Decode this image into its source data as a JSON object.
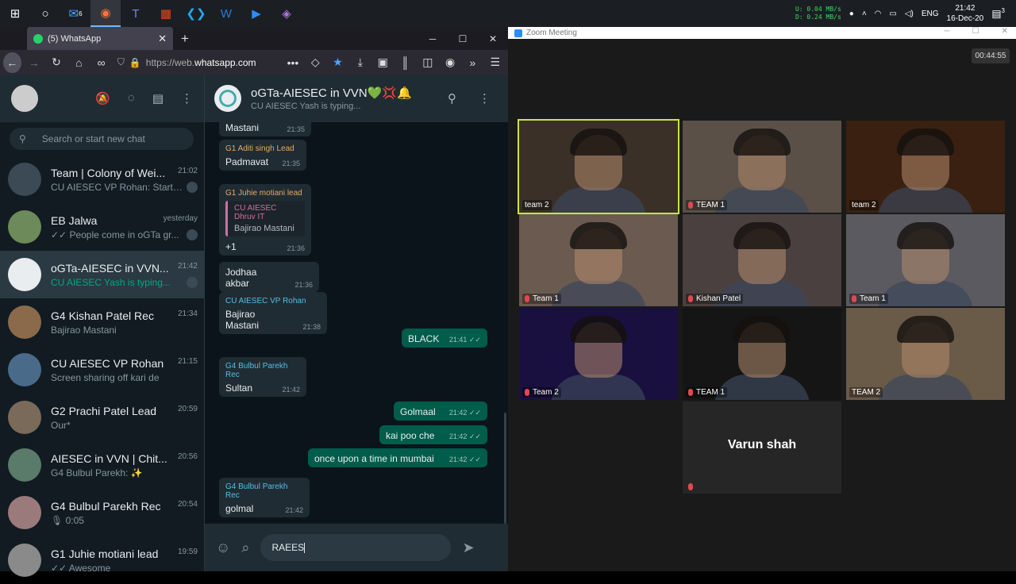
{
  "taskbar": {
    "apps": [
      {
        "name": "windows-start",
        "glyph": "⊞"
      },
      {
        "name": "search",
        "glyph": "○"
      },
      {
        "name": "mail",
        "glyph": "✉"
      },
      {
        "name": "firefox",
        "glyph": "◉"
      },
      {
        "name": "teams",
        "glyph": "T"
      },
      {
        "name": "office",
        "glyph": "▦"
      },
      {
        "name": "vscode",
        "glyph": "❮❯"
      },
      {
        "name": "word",
        "glyph": "W"
      },
      {
        "name": "zoom",
        "glyph": "▶"
      },
      {
        "name": "settings",
        "glyph": "◈"
      }
    ],
    "mail_badge": "6",
    "net_up": "U:    0.04 MB/s",
    "net_down": "D:    0.24 MB/s",
    "lang": "ENG",
    "time": "21:42",
    "date": "16-Dec-20",
    "notif_count": "3"
  },
  "browser": {
    "tab_title": "(5) WhatsApp",
    "url_prefix": "https://web.",
    "url_domain": "whatsapp.com"
  },
  "wa": {
    "search_placeholder": "Search or start new chat",
    "chats": [
      {
        "name": "Team | Colony of Wei...",
        "time": "21:02",
        "last": "CU AIESEC VP Rohan: Start ...",
        "muted": true,
        "avatar": "#3b4a54"
      },
      {
        "name": "EB Jalwa",
        "time": "yesterday",
        "last": "✓✓ People come in oGTa gr...",
        "muted": true,
        "avatar": "#6c8a5a"
      },
      {
        "name": "oGTa-AIESEC in VVN...",
        "time": "21:42",
        "last": "CU AIESEC Yash is typing...",
        "muted": true,
        "typing": true,
        "selected": true,
        "avatar": "#e9edef"
      },
      {
        "name": "G4 Kishan Patel Rec",
        "time": "21:34",
        "last": "Bajirao Mastani",
        "avatar": "#8a6a4a"
      },
      {
        "name": "CU AIESEC VP Rohan",
        "time": "21:15",
        "last": "Screen sharing off kari de",
        "avatar": "#4a6a8a"
      },
      {
        "name": "G2 Prachi Patel Lead",
        "time": "20:59",
        "last": "Our*",
        "avatar": "#7a6a5a"
      },
      {
        "name": "AIESEC in VVN | Chit...",
        "time": "20:56",
        "last": "G4 Bulbul Parekh: ✨",
        "avatar": "#5a7a6a"
      },
      {
        "name": "G4 Bulbul Parekh Rec",
        "time": "20:54",
        "last": "🎙 0:05",
        "avatar": "#9a7a7a"
      },
      {
        "name": "G1 Juhie motiani lead",
        "time": "19:59",
        "last": "✓✓ Awesome",
        "avatar": "#8a8a8a"
      }
    ],
    "conversation": {
      "name": "oGTa-AIESEC in VVN💚💢🔔",
      "status": "CU AIESEC Yash is typing...",
      "messages": [
        {
          "author": "",
          "text": "Bajirao Mastani",
          "time": "21:35",
          "out": false
        },
        {
          "author": "G1 Aditi singh Lead",
          "text": "Padmavat",
          "time": "21:35",
          "out": false,
          "ac": "c1"
        },
        {
          "author": "G1 Juhie motiani lead",
          "quote_author": "CU AIESEC Dhruv IT",
          "quote_text": "Bajirao Mastani",
          "text": "+1",
          "time": "21:36",
          "out": false,
          "ac": "c1"
        },
        {
          "author": "",
          "text": "Jodhaa akbar",
          "time": "21:36",
          "out": false
        },
        {
          "author": "CU AIESEC VP Rohan",
          "text": "Bajirao Mastani",
          "time": "21:38",
          "out": false,
          "ac": "c3"
        },
        {
          "author": "",
          "text": "BLACK",
          "time": "21:41 ✓✓",
          "out": true
        },
        {
          "author": "G4 Bulbul Parekh Rec",
          "text": "Sultan",
          "time": "21:42",
          "out": false,
          "ac": "c3"
        },
        {
          "author": "",
          "text": "Golmaal",
          "time": "21:42 ✓✓",
          "out": true
        },
        {
          "author": "",
          "text": "kai poo che",
          "time": "21:42 ✓✓",
          "out": true
        },
        {
          "author": "",
          "text": "once upon a time in mumbai",
          "time": "21:42 ✓✓",
          "out": true
        },
        {
          "author": "G4 Bulbul Parekh Rec",
          "text": "golmal",
          "time": "21:42",
          "out": false,
          "ac": "c3"
        }
      ],
      "draft": "RAEES"
    }
  },
  "zoom": {
    "window_title": "Zoom Meeting",
    "timer": "00:44:55",
    "participants": [
      {
        "label": "team 2",
        "muted": false,
        "speaking": true,
        "bg": "#3a3028"
      },
      {
        "label": "TEAM 1",
        "muted": true,
        "bg": "#5a5048"
      },
      {
        "label": "team 2",
        "muted": false,
        "bg": "#3a2010"
      },
      {
        "label": "Team 1",
        "muted": true,
        "bg": "#6a5a50"
      },
      {
        "label": "Kishan Patel",
        "muted": true,
        "bg": "#4a4040"
      },
      {
        "label": "Team 1",
        "muted": true,
        "bg": "#5a5a60"
      },
      {
        "label": "Team 2",
        "muted": true,
        "bg": "#1a1040"
      },
      {
        "label": "TEAM 1",
        "muted": true,
        "bg": "#151515"
      },
      {
        "label": "TEAM 2",
        "muted": false,
        "bg": "#6a5a48"
      },
      {
        "label": "",
        "name": "Varun shah",
        "muted": true,
        "bg": "#262626"
      }
    ]
  }
}
